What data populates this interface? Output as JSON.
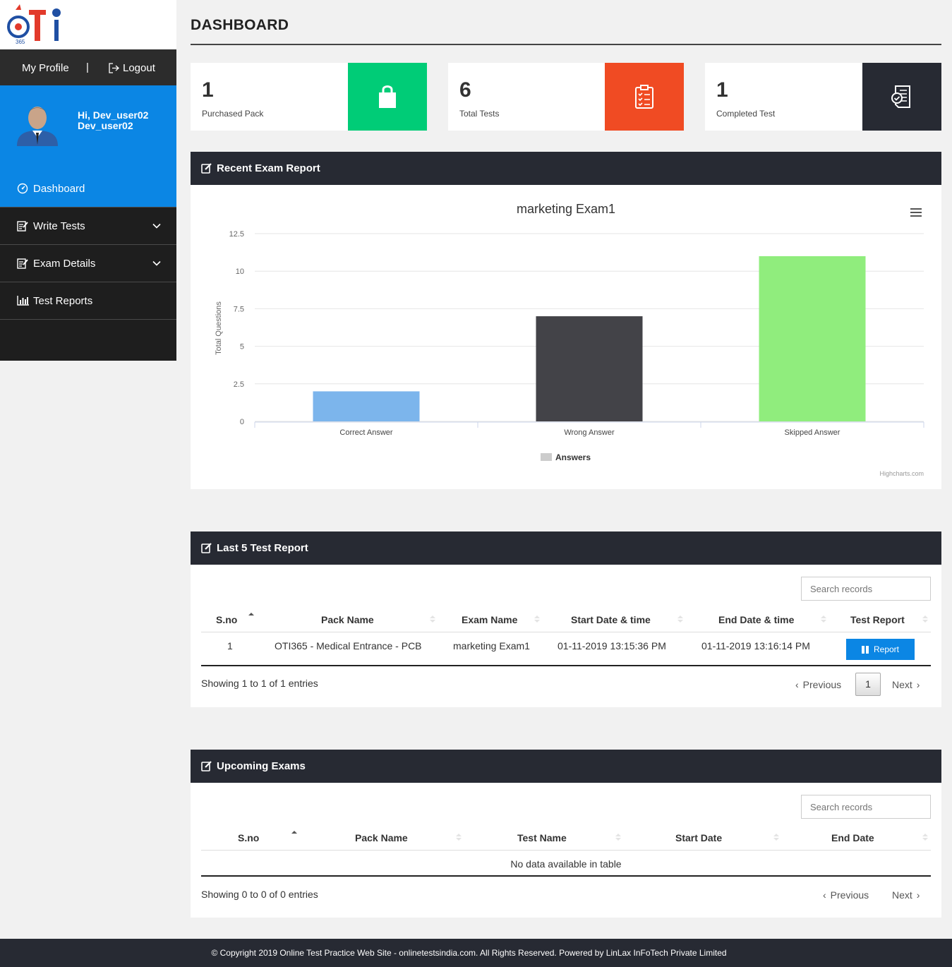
{
  "sidebar": {
    "profile_label": "My Profile",
    "separator": "|",
    "logout_label": "Logout",
    "greeting_line1": "Hi, Dev_user02",
    "greeting_line2": "Dev_user02",
    "items": [
      {
        "label": "Dashboard",
        "icon": "dashboard-icon"
      },
      {
        "label": "Write Tests",
        "icon": "edit-icon"
      },
      {
        "label": "Exam Details",
        "icon": "edit-icon"
      },
      {
        "label": "Test Reports",
        "icon": "bar-chart-icon"
      }
    ]
  },
  "header": {
    "title": "DASHBOARD"
  },
  "stats": [
    {
      "value": "1",
      "label": "Purchased Pack",
      "color": "#00cc77",
      "icon": "shopping-bag-icon"
    },
    {
      "value": "6",
      "label": "Total Tests",
      "color": "#f04b23",
      "icon": "clipboard-list-icon"
    },
    {
      "value": "1",
      "label": "Completed Test",
      "color": "#272a33",
      "icon": "checked-document-icon"
    }
  ],
  "recent_report": {
    "heading": "Recent Exam Report",
    "credit": "Highcharts.com"
  },
  "chart_data": {
    "type": "bar",
    "title": "marketing Exam1",
    "ylabel": "Total Questions",
    "xlabel": "",
    "categories": [
      "Correct Answer",
      "Wrong Answer",
      "Skipped Answer"
    ],
    "values": [
      2,
      7,
      11
    ],
    "colors": [
      "#7cb5ec",
      "#434348",
      "#90ed7d"
    ],
    "yticks": [
      "0",
      "2.5",
      "5",
      "7.5",
      "10",
      "12.5"
    ],
    "ylim": [
      0,
      12.5
    ],
    "legend": "Answers",
    "legend_color": "#cccccc",
    "legend_position": "bottom-center",
    "grid": true
  },
  "last5": {
    "heading": "Last 5 Test Report",
    "search_placeholder": "Search records",
    "columns": [
      "S.no",
      "Pack Name",
      "Exam Name",
      "Start Date & time",
      "End Date & time",
      "Test Report"
    ],
    "rows": [
      {
        "sno": "1",
        "pack": "OTI365 - Medical Entrance - PCB",
        "exam": "marketing Exam1",
        "start": "01-11-2019 13:15:36 PM",
        "end": "01-11-2019 13:16:14 PM",
        "action": "Report"
      }
    ],
    "info": "Showing 1 to 1 of 1 entries",
    "prev": "Previous",
    "next": "Next",
    "page": "1"
  },
  "upcoming": {
    "heading": "Upcoming Exams",
    "search_placeholder": "Search records",
    "columns": [
      "S.no",
      "Pack Name",
      "Test Name",
      "Start Date",
      "End Date"
    ],
    "empty": "No data available in table",
    "info": "Showing 0 to 0 of 0 entries",
    "prev": "Previous",
    "next": "Next"
  },
  "footer": {
    "text": "© Copyright 2019 Online Test Practice Web Site - onlinetestsindia.com. All Rights Reserved. Powered by LinLax InFoTech Private Limited"
  }
}
